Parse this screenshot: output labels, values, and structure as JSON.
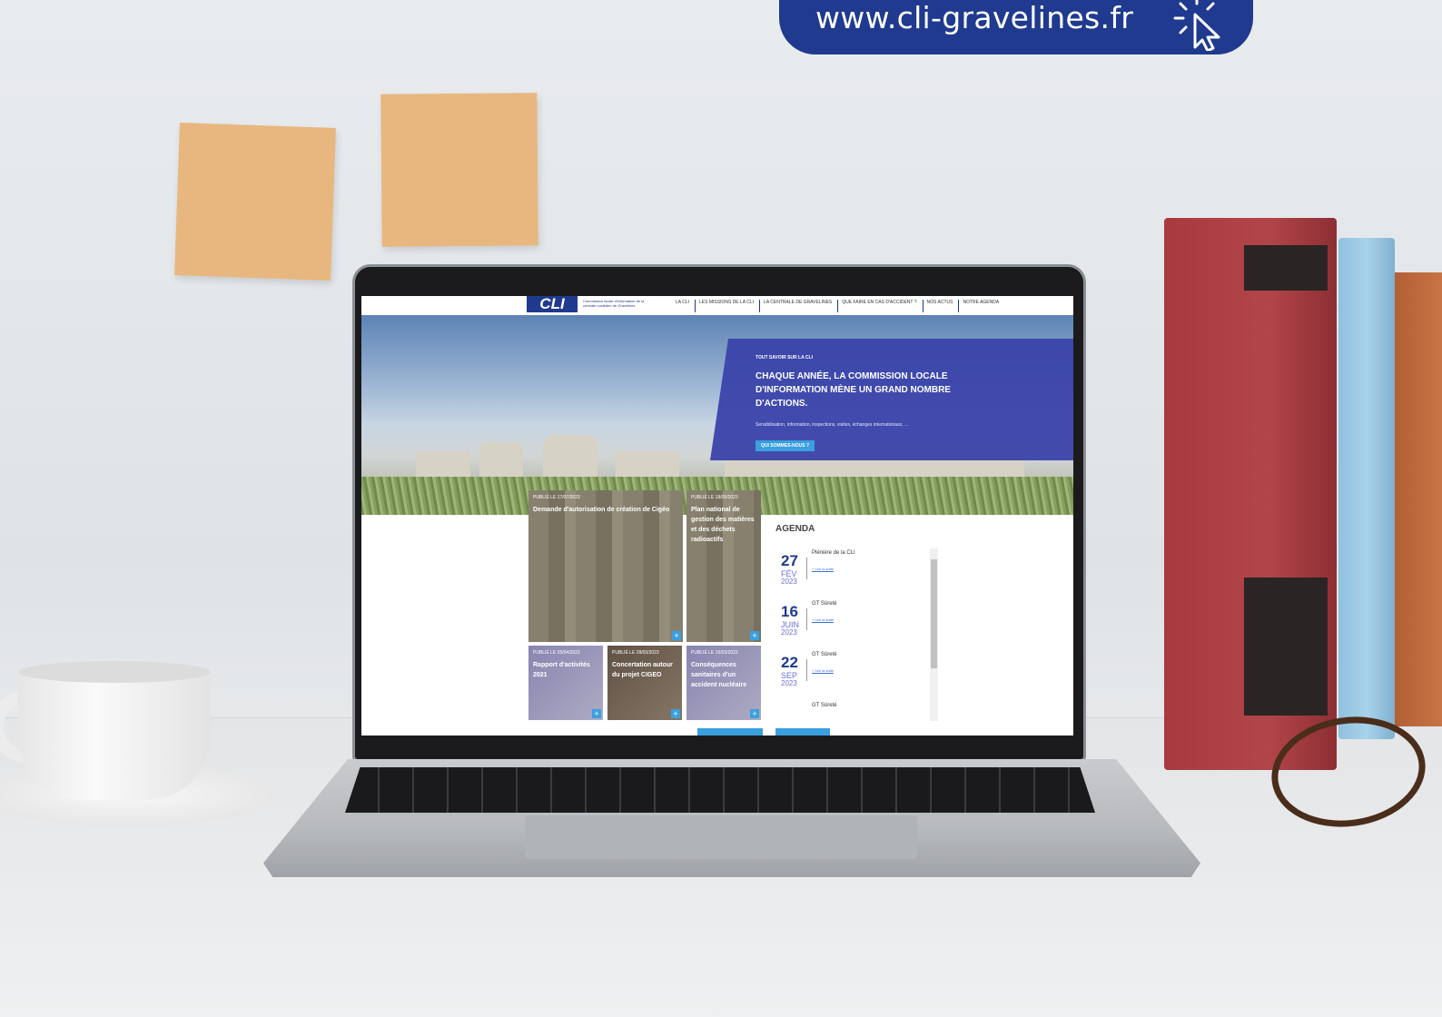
{
  "banner": {
    "url": "www.cli-gravelines.fr",
    "cursor_icon": "click-cursor-icon",
    "color": "#1f3a8e"
  },
  "website": {
    "logo": "CLI",
    "logo_subtitle": "Commission locale d'information de la centrale nucléaire de Gravelines",
    "nav": [
      "LA CLI",
      "LES MISSIONS DE LA CLI",
      "LA CENTRALE DE GRAVELINES",
      "QUE FAIRE EN CAS D'ACCIDENT ?",
      "NOS ACTUS",
      "NOTRE AGENDA"
    ],
    "hero": {
      "kicker": "TOUT SAVOIR SUR LA CLI",
      "title": "CHAQUE ANNÉE, LA COMMISSION LOCALE D'INFORMATION MÈNE UN GRAND NOMBRE D'ACTIONS.",
      "description": "Sensibilisation, information, inspections, visites, échanges internationaux, ...",
      "button": "QUI SOMMES-NOUS ?",
      "panel_color": "#3a43aa"
    },
    "news": [
      {
        "date": "PUBLIÉ LE 17/07/2023",
        "title": "Demande d'autorisation de création de Cigéo"
      },
      {
        "date": "PUBLIÉ LE 18/05/2023",
        "title": "Plan national de gestion des matières et des déchets radioactifs"
      },
      {
        "date": "PUBLIÉ LE 05/04/2023",
        "title": "Rapport d'activités 2021"
      },
      {
        "date": "PUBLIÉ LE 28/03/2023",
        "title": "Concertation autour du projet CIGEO"
      },
      {
        "date": "PUBLIÉ LE 16/03/2023",
        "title": "Conséquences sanitaires d'un accident nucléaire"
      }
    ],
    "plus_label": "+",
    "agenda": {
      "title": "AGENDA",
      "items": [
        {
          "day": "27",
          "month": "FÉV",
          "year": "2023",
          "event": "Plénière de la CLI",
          "link": "+ Lire la suite"
        },
        {
          "day": "16",
          "month": "JUIN",
          "year": "2023",
          "event": "GT Sûreté",
          "link": "+ Lire la suite"
        },
        {
          "day": "22",
          "month": "SEP",
          "year": "2023",
          "event": "GT Sûreté",
          "link": "+ Lire la suite"
        },
        {
          "day": "",
          "month": "",
          "year": "",
          "event": "GT Sûreté",
          "link": ""
        }
      ]
    }
  }
}
